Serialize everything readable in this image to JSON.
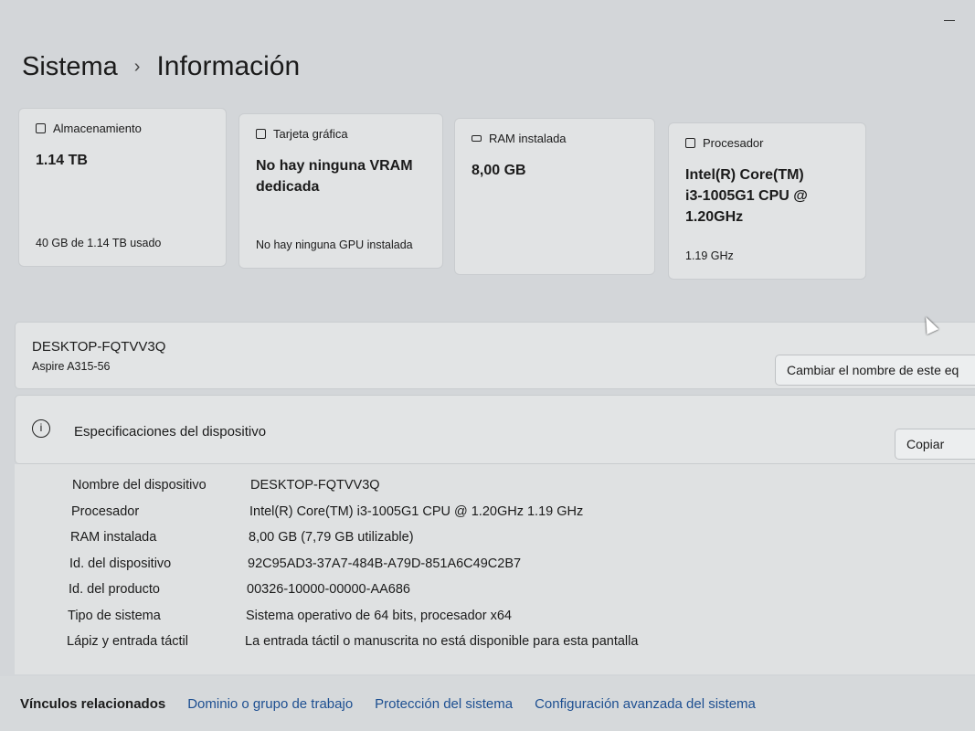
{
  "header": {
    "parent": "Sistema",
    "separator": "›",
    "current": "Información"
  },
  "cards": [
    {
      "icon": "storage-icon",
      "label": "Almacenamiento",
      "value": "1.14 TB",
      "sub": "40 GB de 1.14 TB usado"
    },
    {
      "icon": "graphics-card-icon",
      "label": "Tarjeta gráfica",
      "value": "No hay ninguna VRAM dedicada",
      "sub": "No hay ninguna GPU instalada"
    },
    {
      "icon": "ram-icon",
      "label": "RAM instalada",
      "value": "8,00 GB",
      "sub": ""
    },
    {
      "icon": "processor-icon",
      "label": "Procesador",
      "value": "Intel(R) Core(TM) i3-1005G1 CPU @ 1.20GHz",
      "sub": "1.19 GHz"
    }
  ],
  "device": {
    "name": "DESKTOP-FQTVV3Q",
    "model": "Aspire A315-56",
    "rename_label": "Cambiar el nombre de este eq"
  },
  "specs": {
    "title": "Especificaciones del dispositivo",
    "copy_label": "Copiar",
    "rows": [
      {
        "k": "Nombre del dispositivo",
        "v": "DESKTOP-FQTVV3Q"
      },
      {
        "k": "Procesador",
        "v": "Intel(R) Core(TM) i3-1005G1 CPU @ 1.20GHz   1.19 GHz"
      },
      {
        "k": "RAM instalada",
        "v": "8,00 GB (7,79 GB utilizable)"
      },
      {
        "k": "Id. del dispositivo",
        "v": "92C95AD3-37A7-484B-A79D-851A6C49C2B7"
      },
      {
        "k": "Id. del producto",
        "v": "00326-10000-00000-AA686"
      },
      {
        "k": "Tipo de sistema",
        "v": "Sistema operativo de 64 bits, procesador x64"
      },
      {
        "k": "Lápiz y entrada táctil",
        "v": "La entrada táctil o manuscrita no está disponible para esta pantalla"
      }
    ]
  },
  "related": {
    "label": "Vínculos relacionados",
    "links": [
      "Dominio o grupo de trabajo",
      "Protección del sistema",
      "Configuración avanzada del sistema"
    ]
  },
  "colors": {
    "link": "#1d4f91",
    "background": "#d3d6d9"
  }
}
